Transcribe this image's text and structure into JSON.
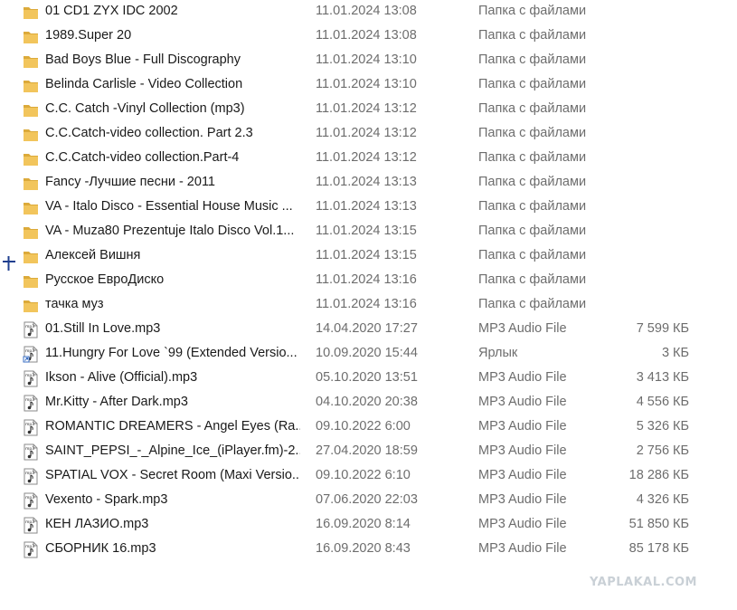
{
  "colors": {
    "folder": "#f2c55c",
    "folder_dark": "#dcaa3a",
    "text": "#1a1a1a",
    "muted": "#6d6d6d",
    "cursor": "#1f3f8f",
    "watermark": "#c9d0d6"
  },
  "watermark": "YAPLAKAL.COM",
  "files": [
    {
      "icon": "folder-icon",
      "name": "01 CD1 ZYX IDC 2002",
      "date": "11.01.2024 13:08",
      "type": "Папка с файлами",
      "size": ""
    },
    {
      "icon": "folder-icon",
      "name": "1989.Super 20",
      "date": "11.01.2024 13:08",
      "type": "Папка с файлами",
      "size": ""
    },
    {
      "icon": "folder-icon",
      "name": "Bad Boys Blue - Full Discography",
      "date": "11.01.2024 13:10",
      "type": "Папка с файлами",
      "size": ""
    },
    {
      "icon": "folder-icon",
      "name": "Belinda Carlisle - Video Collection",
      "date": "11.01.2024 13:10",
      "type": "Папка с файлами",
      "size": ""
    },
    {
      "icon": "folder-icon",
      "name": "C.C. Catch -Vinyl Collection (mp3)",
      "date": "11.01.2024 13:12",
      "type": "Папка с файлами",
      "size": ""
    },
    {
      "icon": "folder-icon",
      "name": "C.C.Catch-video collection. Part   2.3",
      "date": "11.01.2024 13:12",
      "type": "Папка с файлами",
      "size": ""
    },
    {
      "icon": "folder-icon",
      "name": "C.C.Catch-video collection.Part-4",
      "date": "11.01.2024 13:12",
      "type": "Папка с файлами",
      "size": ""
    },
    {
      "icon": "folder-icon",
      "name": "Fancy -Лучшие песни - 2011",
      "date": "11.01.2024 13:13",
      "type": "Папка с файлами",
      "size": ""
    },
    {
      "icon": "folder-icon",
      "name": "VA - Italo Disco - Essential House Music ...",
      "date": "11.01.2024 13:13",
      "type": "Папка с файлами",
      "size": ""
    },
    {
      "icon": "folder-icon",
      "name": "VA - Muza80 Prezentuje Italo Disco Vol.1...",
      "date": "11.01.2024 13:15",
      "type": "Папка с файлами",
      "size": ""
    },
    {
      "icon": "folder-icon",
      "name": "Алексей Вишня",
      "date": "11.01.2024 13:15",
      "type": "Папка с файлами",
      "size": ""
    },
    {
      "icon": "folder-icon",
      "name": "Русское ЕвроДиско",
      "date": "11.01.2024 13:16",
      "type": "Папка с файлами",
      "size": ""
    },
    {
      "icon": "folder-icon",
      "name": "тачка муз",
      "date": "11.01.2024 13:16",
      "type": "Папка с файлами",
      "size": ""
    },
    {
      "icon": "mp3-file-icon",
      "name": "01.Still In Love.mp3",
      "date": "14.04.2020 17:27",
      "type": "MP3 Audio File",
      "size": "7 599 КБ"
    },
    {
      "icon": "shortcut-mp3-icon",
      "name": "11.Hungry For Love `99 (Extended Versio...",
      "date": "10.09.2020 15:44",
      "type": "Ярлык",
      "size": "3 КБ"
    },
    {
      "icon": "mp3-file-icon",
      "name": "Ikson - Alive (Official).mp3",
      "date": "05.10.2020 13:51",
      "type": "MP3 Audio File",
      "size": "3 413 КБ"
    },
    {
      "icon": "mp3-file-icon",
      "name": "Mr.Kitty - After Dark.mp3",
      "date": "04.10.2020 20:38",
      "type": "MP3 Audio File",
      "size": "4 556 КБ"
    },
    {
      "icon": "mp3-file-icon",
      "name": "ROMANTIC DREAMERS - Angel Eyes (Ra...",
      "date": "09.10.2022 6:00",
      "type": "MP3 Audio File",
      "size": "5 326 КБ"
    },
    {
      "icon": "mp3-file-icon",
      "name": "SAINT_PEPSI_-_Alpine_Ice_(iPlayer.fm)-2...",
      "date": "27.04.2020 18:59",
      "type": "MP3 Audio File",
      "size": "2 756 КБ"
    },
    {
      "icon": "mp3-file-icon",
      "name": "SPATIAL VOX - Secret Room (Maxi Versio...",
      "date": "09.10.2022 6:10",
      "type": "MP3 Audio File",
      "size": "18 286 КБ"
    },
    {
      "icon": "mp3-file-icon",
      "name": "Vexento - Spark.mp3",
      "date": "07.06.2020 22:03",
      "type": "MP3 Audio File",
      "size": "4 326 КБ"
    },
    {
      "icon": "mp3-file-icon",
      "name": "КЕН ЛАЗИО.mp3",
      "date": "16.09.2020 8:14",
      "type": "MP3 Audio File",
      "size": "51 850 КБ"
    },
    {
      "icon": "mp3-file-icon",
      "name": "СБОРНИК 16.mp3",
      "date": "16.09.2020 8:43",
      "type": "MP3 Audio File",
      "size": "85 178 КБ"
    }
  ]
}
